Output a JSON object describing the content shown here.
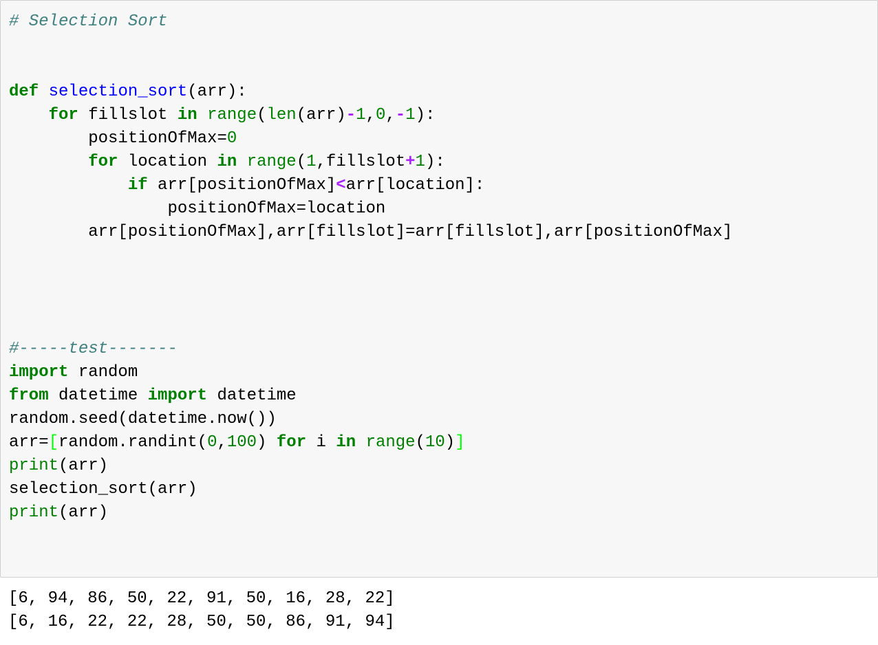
{
  "colors": {
    "keyword": "#008000",
    "def_name": "#0000ff",
    "builtin": "#008000",
    "number": "#008000",
    "operator": "#aa22ff",
    "comment": "#408080",
    "bracket_highlight": "#00ff00",
    "text": "#000000",
    "cell_bg": "#f7f7f7"
  },
  "code": {
    "lines": [
      [
        {
          "t": "# Selection Sort",
          "k": "comment"
        }
      ],
      [],
      [],
      [
        {
          "t": "def",
          "k": "keyword"
        },
        {
          "t": " ",
          "k": "text"
        },
        {
          "t": "selection_sort",
          "k": "def_name"
        },
        {
          "t": "(arr):",
          "k": "text"
        }
      ],
      [
        {
          "t": "    ",
          "k": "text"
        },
        {
          "t": "for",
          "k": "keyword"
        },
        {
          "t": " fillslot ",
          "k": "text"
        },
        {
          "t": "in",
          "k": "keyword"
        },
        {
          "t": " ",
          "k": "text"
        },
        {
          "t": "range",
          "k": "builtin"
        },
        {
          "t": "(",
          "k": "text"
        },
        {
          "t": "len",
          "k": "builtin"
        },
        {
          "t": "(arr)",
          "k": "text"
        },
        {
          "t": "-",
          "k": "operator"
        },
        {
          "t": "1",
          "k": "number"
        },
        {
          "t": ",",
          "k": "text"
        },
        {
          "t": "0",
          "k": "number"
        },
        {
          "t": ",",
          "k": "text"
        },
        {
          "t": "-",
          "k": "operator"
        },
        {
          "t": "1",
          "k": "number"
        },
        {
          "t": "):",
          "k": "text"
        }
      ],
      [
        {
          "t": "        positionOfMax=",
          "k": "text"
        },
        {
          "t": "0",
          "k": "number"
        }
      ],
      [
        {
          "t": "        ",
          "k": "text"
        },
        {
          "t": "for",
          "k": "keyword"
        },
        {
          "t": " location ",
          "k": "text"
        },
        {
          "t": "in",
          "k": "keyword"
        },
        {
          "t": " ",
          "k": "text"
        },
        {
          "t": "range",
          "k": "builtin"
        },
        {
          "t": "(",
          "k": "text"
        },
        {
          "t": "1",
          "k": "number"
        },
        {
          "t": ",fillslot",
          "k": "text"
        },
        {
          "t": "+",
          "k": "operator"
        },
        {
          "t": "1",
          "k": "number"
        },
        {
          "t": "):",
          "k": "text"
        }
      ],
      [
        {
          "t": "            ",
          "k": "text"
        },
        {
          "t": "if",
          "k": "keyword"
        },
        {
          "t": " arr[positionOfMax]",
          "k": "text"
        },
        {
          "t": "<",
          "k": "operator"
        },
        {
          "t": "arr[location]:",
          "k": "text"
        }
      ],
      [
        {
          "t": "                positionOfMax=location",
          "k": "text"
        }
      ],
      [
        {
          "t": "        arr[positionOfMax],arr[fillslot]=arr[fillslot],arr[positionOfMax]",
          "k": "text"
        }
      ],
      [],
      [],
      [],
      [],
      [
        {
          "t": "#-----test-------",
          "k": "comment"
        }
      ],
      [
        {
          "t": "import",
          "k": "keyword"
        },
        {
          "t": " random",
          "k": "text"
        }
      ],
      [
        {
          "t": "from",
          "k": "keyword"
        },
        {
          "t": " datetime ",
          "k": "text"
        },
        {
          "t": "import",
          "k": "keyword"
        },
        {
          "t": " datetime",
          "k": "text"
        }
      ],
      [
        {
          "t": "random.seed(datetime.now())",
          "k": "text"
        }
      ],
      [
        {
          "t": "arr=",
          "k": "text"
        },
        {
          "t": "[",
          "k": "bracket_highlight"
        },
        {
          "t": "random.randint(",
          "k": "text"
        },
        {
          "t": "0",
          "k": "number"
        },
        {
          "t": ",",
          "k": "text"
        },
        {
          "t": "100",
          "k": "number"
        },
        {
          "t": ") ",
          "k": "text"
        },
        {
          "t": "for",
          "k": "keyword"
        },
        {
          "t": " i ",
          "k": "text"
        },
        {
          "t": "in",
          "k": "keyword"
        },
        {
          "t": " ",
          "k": "text"
        },
        {
          "t": "range",
          "k": "builtin"
        },
        {
          "t": "(",
          "k": "text"
        },
        {
          "t": "10",
          "k": "number"
        },
        {
          "t": ")",
          "k": "text"
        },
        {
          "t": "]",
          "k": "bracket_highlight"
        }
      ],
      [
        {
          "t": "print",
          "k": "builtin"
        },
        {
          "t": "(arr)",
          "k": "text"
        }
      ],
      [
        {
          "t": "selection_sort(arr)",
          "k": "text"
        }
      ],
      [
        {
          "t": "print",
          "k": "builtin"
        },
        {
          "t": "(arr)",
          "k": "text"
        }
      ]
    ]
  },
  "output": {
    "lines": [
      "[6, 94, 86, 50, 22, 91, 50, 16, 28, 22]",
      "[6, 16, 22, 22, 28, 50, 50, 86, 91, 94]"
    ]
  }
}
